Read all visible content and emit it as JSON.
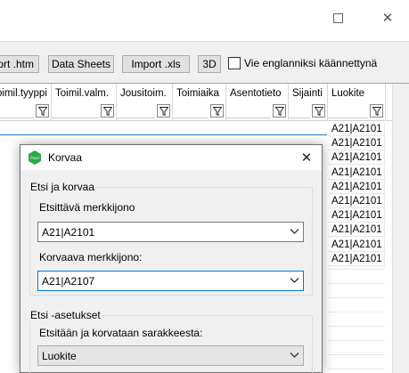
{
  "main": {
    "toolbar": {
      "export_htm": "ort .htm",
      "data_sheets": "Data Sheets",
      "import_xls": "Import .xls",
      "btn_3d": "3D",
      "english_checkbox_label": "Vie englanniksi käännettynä",
      "english_checked": false
    },
    "columns": [
      "oimil.tyyppi",
      "Toimil.valm.",
      "Jousitoim.",
      "Toimiaika",
      "Asentotieto",
      "Sijainti",
      "Luokite"
    ],
    "luokite_rows": [
      "A21|A2101",
      "A21|A2101",
      "A21|A2101",
      "A21|A2101",
      "A21|A2101",
      "A21|A2101",
      "A21|A2101",
      "A21|A2101",
      "A21|A2101",
      "A21|A2101"
    ]
  },
  "dialog": {
    "title": "Korvaa",
    "icon_label": "Pixel",
    "find_group_title": "Etsi ja korvaa",
    "find_label": "Etsittävä merkkijono",
    "find_value": "A21|A2101",
    "replace_label": "Korvaava merkkijono:",
    "replace_value": "A21|A2107",
    "options_group_title": "Etsi -asetukset",
    "column_label": "Etsitään ja korvataan sarakkeesta:",
    "column_value": "Luokite"
  },
  "colors": {
    "accent": "#0078d7",
    "icon_green": "#2aa84a"
  }
}
